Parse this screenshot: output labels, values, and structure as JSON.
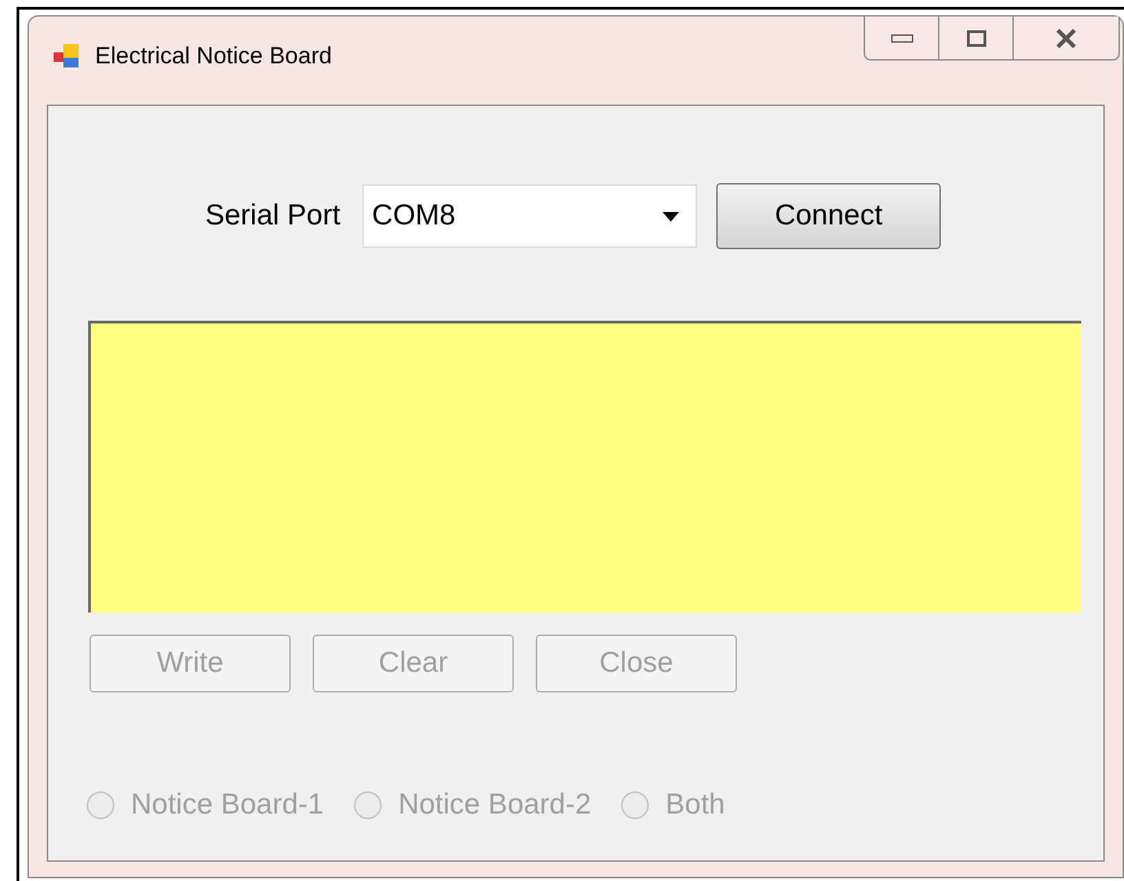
{
  "window": {
    "title": "Electrical Notice Board"
  },
  "serial_port": {
    "label": "Serial Port",
    "value": "COM8"
  },
  "connect_button": {
    "label": "Connect",
    "disabled": false
  },
  "buttons": [
    {
      "label": "Write",
      "disabled": true
    },
    {
      "label": "Clear",
      "disabled": true
    },
    {
      "label": "Close",
      "disabled": true
    }
  ],
  "radios": [
    {
      "label": "Notice Board-1",
      "selected": false,
      "disabled": true
    },
    {
      "label": "Notice Board-2",
      "selected": false,
      "disabled": true
    },
    {
      "label": "Both",
      "selected": false,
      "disabled": true
    }
  ]
}
